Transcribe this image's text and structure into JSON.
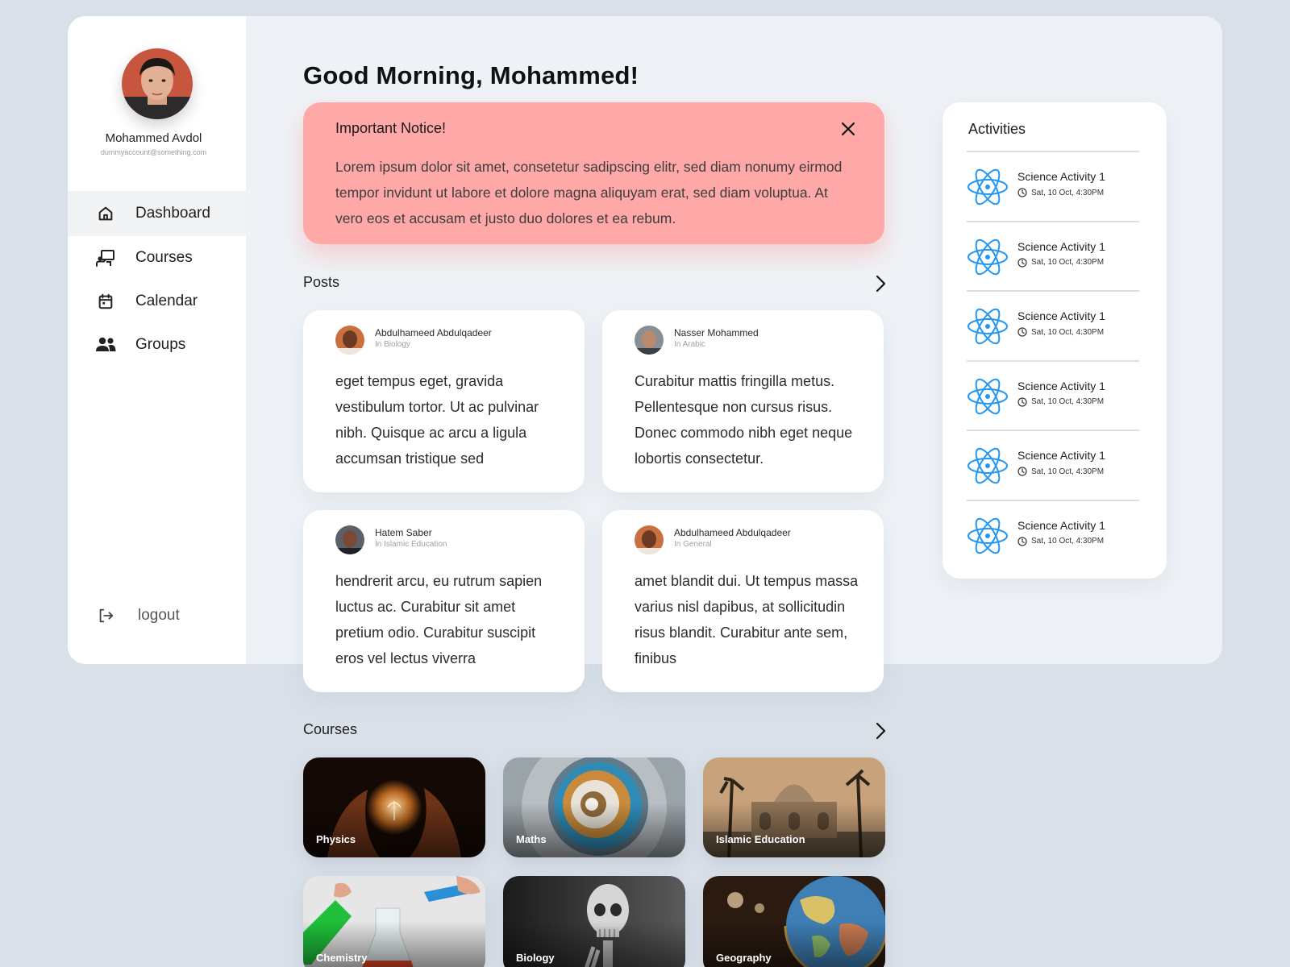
{
  "profile": {
    "name": "Mohammed Avdol",
    "email": "dummyaccount@something.com"
  },
  "nav": {
    "items": [
      {
        "label": "Dashboard",
        "icon": "home-icon",
        "active": true
      },
      {
        "label": "Courses",
        "icon": "classroom-icon",
        "active": false
      },
      {
        "label": "Calendar",
        "icon": "calendar-icon",
        "active": false
      },
      {
        "label": "Groups",
        "icon": "groups-icon",
        "active": false
      }
    ],
    "logout_label": "logout"
  },
  "greeting": "Good Morning, Mohammed!",
  "notice": {
    "title": "Important Notice!",
    "body": "Lorem ipsum dolor sit amet, consetetur sadipscing elitr, sed diam nonumy eirmod tempor invidunt ut labore et dolore magna aliquyam erat, sed diam voluptua. At vero eos et accusam et justo duo dolores et ea rebum.",
    "color": "#ffa8a8"
  },
  "posts": {
    "title": "Posts",
    "items": [
      {
        "author": "Abdulhameed Abdulqadeer",
        "group": "In Biology",
        "body": "eget tempus eget, gravida vestibulum tortor. Ut ac pulvinar nibh. Quisque ac arcu a ligula accumsan tristique sed"
      },
      {
        "author": "Nasser Mohammed",
        "group": "In Arabic",
        "body": "Curabitur mattis fringilla metus. Pellentesque non cursus risus. Donec commodo nibh eget neque lobortis consectetur."
      },
      {
        "author": "Hatem Saber",
        "group": "In Islamic Education",
        "body": "hendrerit arcu, eu rutrum sapien luctus ac. Curabitur sit amet pretium odio. Curabitur suscipit eros vel lectus viverra"
      },
      {
        "author": "Abdulhameed Abdulqadeer",
        "group": "In General",
        "body": "amet blandit dui. Ut tempus massa varius nisl dapibus, at sollicitudin risus blandit. Curabitur ante sem, finibus"
      }
    ]
  },
  "activities": {
    "title": "Activities",
    "icon": "atom-icon",
    "accent": "#2196f3",
    "items": [
      {
        "name": "Science Activity 1",
        "time": "Sat, 10 Oct, 4:30PM"
      },
      {
        "name": "Science Activity 1",
        "time": "Sat, 10 Oct, 4:30PM"
      },
      {
        "name": "Science Activity 1",
        "time": "Sat, 10 Oct, 4:30PM"
      },
      {
        "name": "Science Activity 1",
        "time": "Sat, 10 Oct, 4:30PM"
      },
      {
        "name": "Science Activity 1",
        "time": "Sat, 10 Oct, 4:30PM"
      },
      {
        "name": "Science Activity 1",
        "time": "Sat, 10 Oct, 4:30PM"
      }
    ]
  },
  "courses": {
    "title": "Courses",
    "items": [
      {
        "label": "Physics"
      },
      {
        "label": "Maths"
      },
      {
        "label": "Islamic Education"
      },
      {
        "label": "Chemistry"
      },
      {
        "label": "Biology"
      },
      {
        "label": "Geography"
      }
    ]
  }
}
